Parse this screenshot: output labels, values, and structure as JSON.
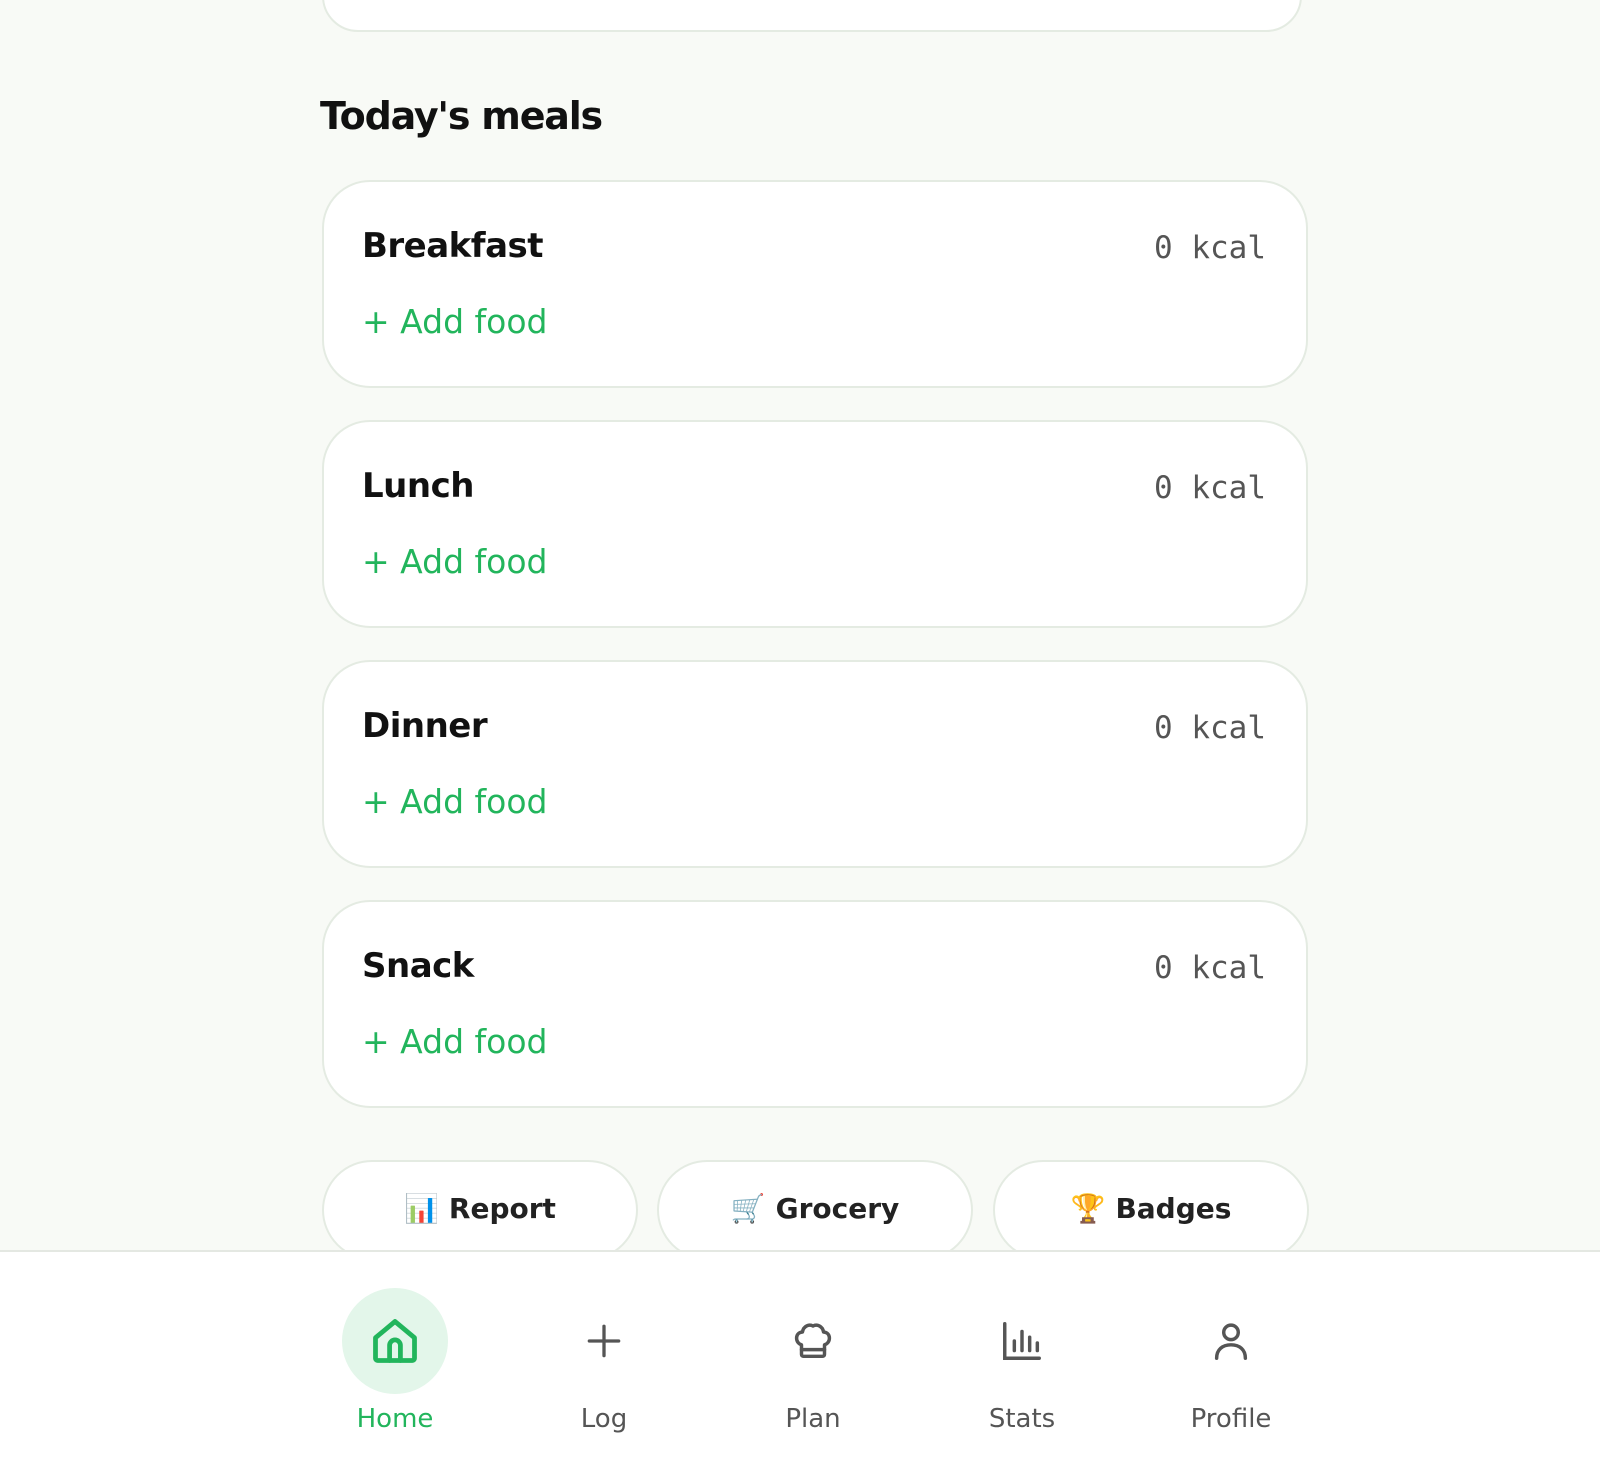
{
  "section_title": "Today's meals",
  "meals": [
    {
      "name": "Breakfast",
      "kcal": "0 kcal",
      "add_label": "+ Add food"
    },
    {
      "name": "Lunch",
      "kcal": "0 kcal",
      "add_label": "+ Add food"
    },
    {
      "name": "Dinner",
      "kcal": "0 kcal",
      "add_label": "+ Add food"
    },
    {
      "name": "Snack",
      "kcal": "0 kcal",
      "add_label": "+ Add food"
    }
  ],
  "quick_actions": [
    {
      "emoji": "📊",
      "label": "Report"
    },
    {
      "emoji": "🛒",
      "label": "Grocery"
    },
    {
      "emoji": "🏆",
      "label": "Badges"
    }
  ],
  "nav": {
    "active": "home",
    "items": [
      {
        "label": "Home",
        "icon": "home-icon"
      },
      {
        "label": "Log",
        "icon": "plus-icon"
      },
      {
        "label": "Plan",
        "icon": "chef-hat-icon"
      },
      {
        "label": "Stats",
        "icon": "bar-chart-icon"
      },
      {
        "label": "Profile",
        "icon": "user-icon"
      }
    ]
  },
  "colors": {
    "accent": "#22b55c",
    "accent_soft": "#e3f6ea",
    "background": "#f8faf6",
    "card_border": "#e4ebe2"
  }
}
